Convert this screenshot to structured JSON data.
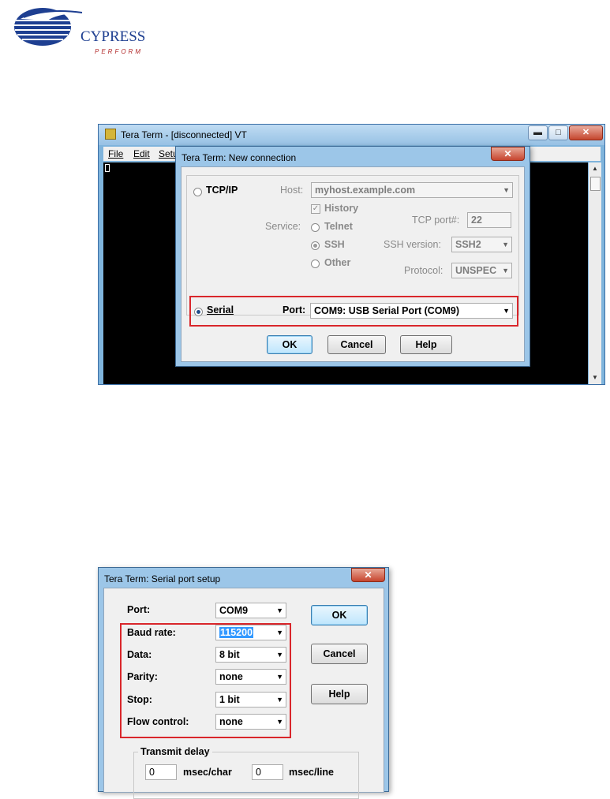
{
  "logo": {
    "brand": "CYPRESS",
    "tagline": "PERFORM"
  },
  "teraterm": {
    "title": "Tera Term - [disconnected] VT",
    "menu": [
      "File",
      "Edit",
      "Setu"
    ],
    "window_buttons": {
      "minimize": "▬",
      "maximize": "□",
      "close": "✕"
    }
  },
  "new_connection": {
    "title": "Tera Term: New connection",
    "close": "✕",
    "tcpip_label": "TCP/IP",
    "host_label": "Host:",
    "host_value": "myhost.example.com",
    "history_label": "History",
    "service_label": "Service:",
    "telnet_label": "Telnet",
    "ssh_label": "SSH",
    "other_label": "Other",
    "tcp_port_label": "TCP port#:",
    "tcp_port_value": "22",
    "ssh_version_label": "SSH version:",
    "ssh_version_value": "SSH2",
    "protocol_label": "Protocol:",
    "protocol_value": "UNSPEC",
    "serial_label": "Serial",
    "port_label": "Port:",
    "port_value": "COM9: USB Serial Port (COM9)",
    "buttons": {
      "ok": "OK",
      "cancel": "Cancel",
      "help": "Help"
    }
  },
  "serial_setup": {
    "title": "Tera Term: Serial port setup",
    "close": "✕",
    "port_label": "Port:",
    "port_value": "COM9",
    "baud_label": "Baud rate:",
    "baud_value": "115200",
    "data_label": "Data:",
    "data_value": "8 bit",
    "parity_label": "Parity:",
    "parity_value": "none",
    "stop_label": "Stop:",
    "stop_value": "1 bit",
    "flow_label": "Flow control:",
    "flow_value": "none",
    "transmit_delay_label": "Transmit delay",
    "char_delay_value": "0",
    "char_delay_unit": "msec/char",
    "line_delay_value": "0",
    "line_delay_unit": "msec/line",
    "buttons": {
      "ok": "OK",
      "cancel": "Cancel",
      "help": "Help"
    }
  },
  "colors": {
    "highlight_box": "#d9262b",
    "brand_blue": "#1e3f91",
    "brand_red": "#b22a2a"
  }
}
